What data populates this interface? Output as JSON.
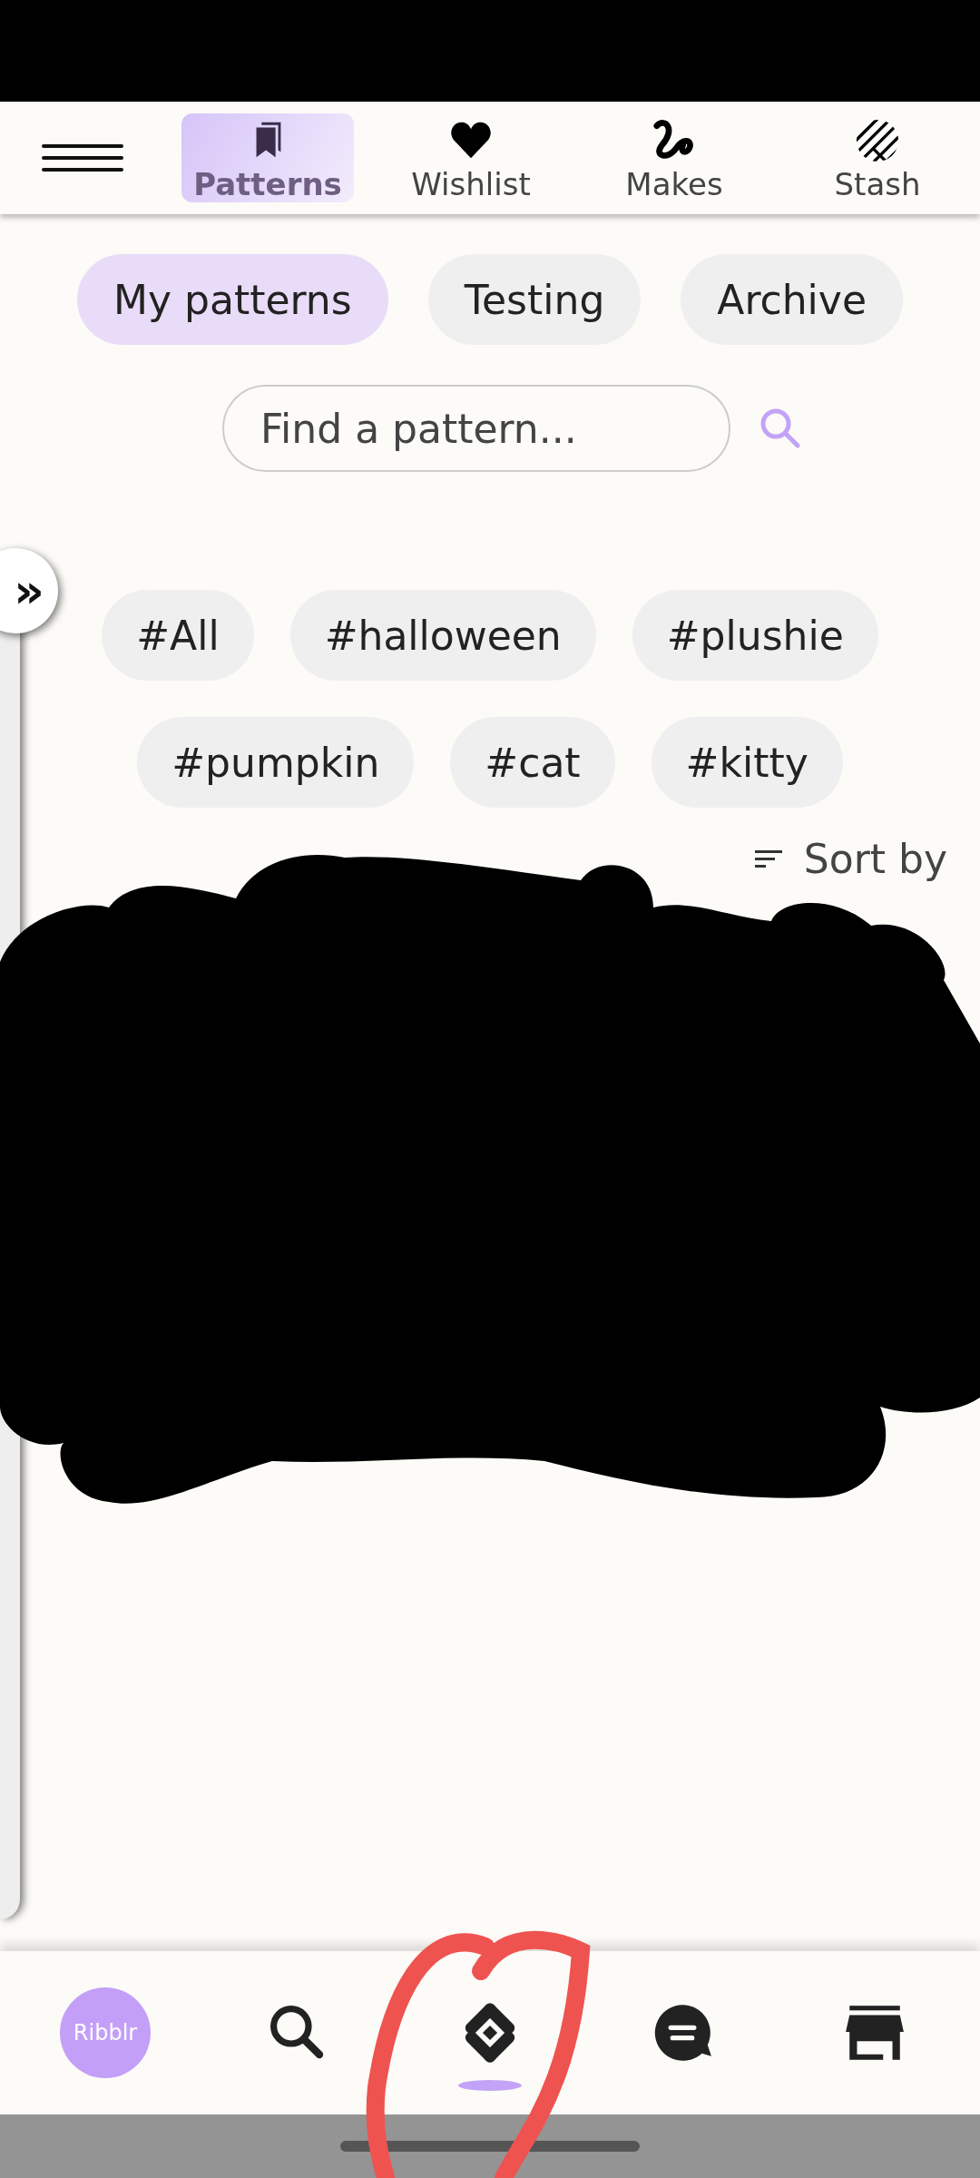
{
  "top_tabs": [
    {
      "label": "Patterns",
      "selected": true,
      "kind": "patterns"
    },
    {
      "label": "Wishlist",
      "selected": false,
      "kind": "wishlist"
    },
    {
      "label": "Makes",
      "selected": false,
      "kind": "makes"
    },
    {
      "label": "Stash",
      "selected": false,
      "kind": "stash"
    }
  ],
  "filters": [
    {
      "label": "My patterns",
      "selected": true
    },
    {
      "label": "Testing",
      "selected": false
    },
    {
      "label": "Archive",
      "selected": false
    }
  ],
  "search": {
    "placeholder": "Find a pattern..."
  },
  "tags": [
    [
      "#All",
      "#halloween",
      "#plushie"
    ],
    [
      "#pumpkin",
      "#cat",
      "#kitty"
    ]
  ],
  "drawer_handle": "»",
  "sort": {
    "label": "Sort by"
  },
  "bottom_nav": [
    {
      "kind": "logo",
      "label": "Ribblr",
      "selected": false
    },
    {
      "kind": "search",
      "selected": false
    },
    {
      "kind": "patterns",
      "selected": true
    },
    {
      "kind": "chat",
      "selected": false
    },
    {
      "kind": "shop",
      "selected": false
    }
  ]
}
